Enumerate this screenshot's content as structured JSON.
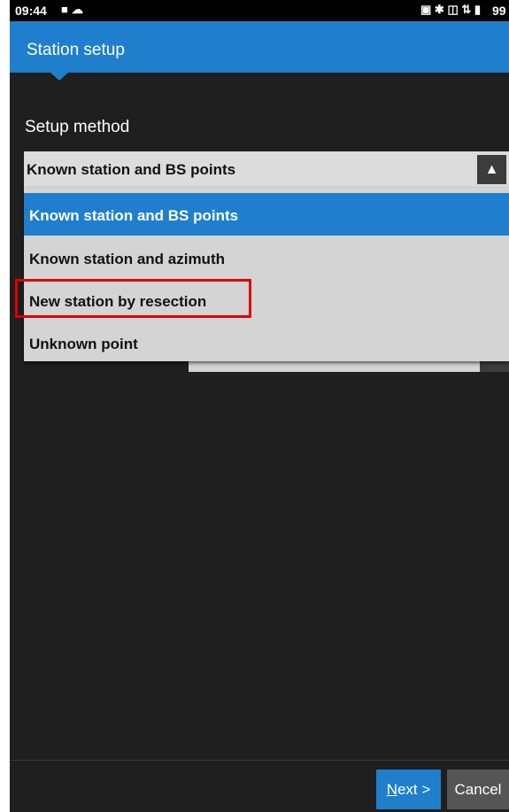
{
  "status_bar": {
    "time": "09:44",
    "left_icons": [
      "video-icon",
      "cloud-icon"
    ],
    "right_icons": [
      "cast-icon",
      "bluetooth-icon",
      "vibrate-icon",
      "wifi-icon",
      "battery-icon"
    ],
    "battery_text": "99"
  },
  "app_bar": {
    "title": "Station setup"
  },
  "setup": {
    "label": "Setup method",
    "selected_value": "Known station and BS points",
    "options": [
      {
        "label": "Known station and BS points",
        "selected": true
      },
      {
        "label": "Known station and azimuth",
        "selected": false
      },
      {
        "label": "New station by resection",
        "selected": false,
        "highlighted": true
      },
      {
        "label": "Unknown point",
        "selected": false
      }
    ]
  },
  "footer": {
    "next_mnemonic": "N",
    "next_rest": "ext >",
    "cancel_label": "Cancel"
  },
  "colors": {
    "accent": "#1f7fcc",
    "background": "#1f1f1f",
    "highlight": "#e00000"
  }
}
